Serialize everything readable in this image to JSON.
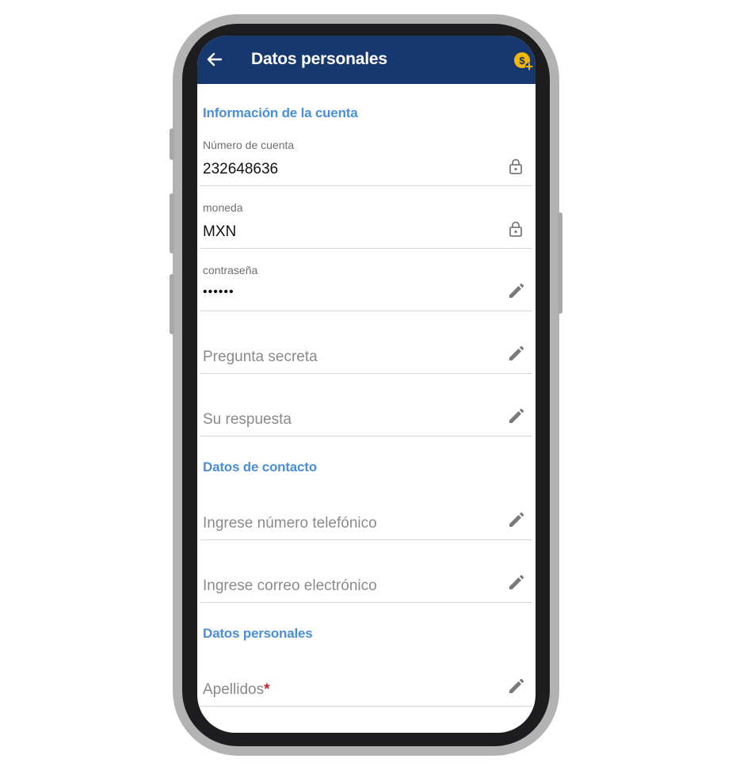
{
  "header": {
    "title": "Datos personales",
    "back_icon": "arrow-left-icon",
    "action_icon": "coin-add-icon",
    "bg_color": "#17386f",
    "coin_color": "#f2b705"
  },
  "sections": {
    "account": {
      "title": "Información de la cuenta"
    },
    "contact": {
      "title": "Datos de contacto"
    },
    "personal": {
      "title": "Datos personales"
    }
  },
  "fields": {
    "account_number": {
      "label": "Número de cuenta",
      "value": "232648636",
      "icon": "lock-icon"
    },
    "currency": {
      "label": "moneda",
      "value": "MXN",
      "icon": "lock-icon"
    },
    "password": {
      "label": "contraseña",
      "value": "••••••",
      "icon": "pencil-icon"
    },
    "secret_question": {
      "placeholder": "Pregunta secreta",
      "icon": "pencil-icon"
    },
    "answer": {
      "placeholder": "Su respuesta",
      "icon": "pencil-icon"
    },
    "phone": {
      "placeholder": "Ingrese número telefónico",
      "icon": "pencil-icon"
    },
    "email": {
      "placeholder": "Ingrese correo electrónico",
      "icon": "pencil-icon"
    },
    "last_names": {
      "placeholder": "Apellidos",
      "required_mark": "*",
      "icon": "pencil-icon"
    }
  },
  "colors": {
    "section_title": "#4a8fd8",
    "required": "#c62828"
  }
}
